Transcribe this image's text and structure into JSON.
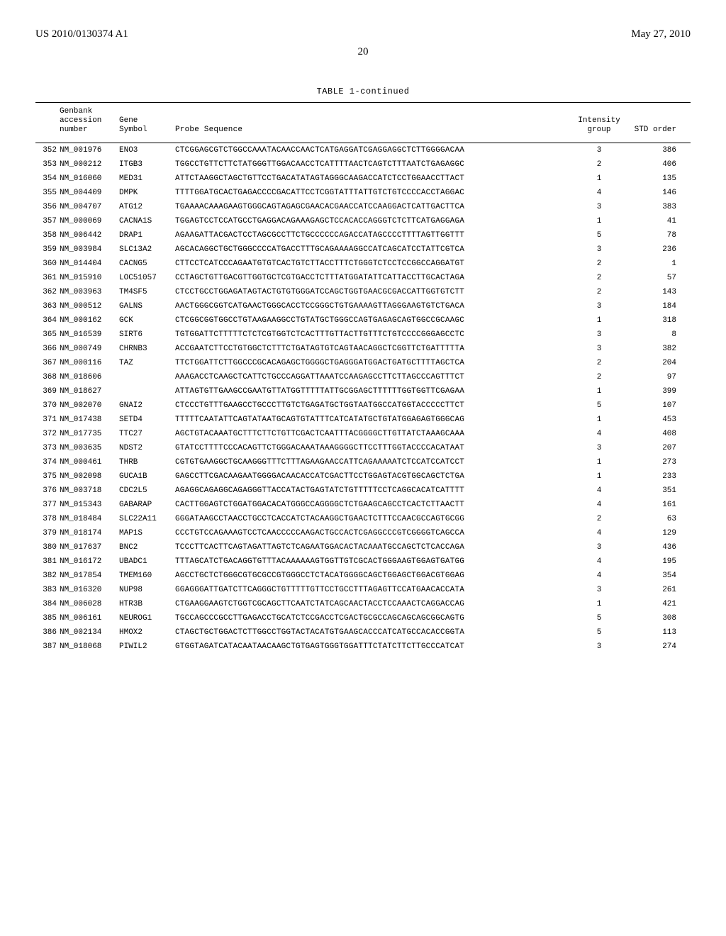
{
  "header": {
    "left": "US 2010/0130374 A1",
    "right": "May 27, 2010"
  },
  "page_number": "20",
  "table": {
    "title": "TABLE 1-continued",
    "columns": {
      "accession": "Genbank\naccession\nnumber",
      "symbol": "Gene\nSymbol",
      "sequence": "Probe Sequence",
      "intensity": "Intensity\ngroup",
      "std": "STD order"
    },
    "rows": [
      {
        "idx": "352",
        "acc": "NM_001976",
        "sym": "ENO3",
        "seq": "CTCGGAGCGTCTGGCCAAATACAACCAACTCATGAGGATCGAGGAGGCTCTTGGGGACAA",
        "int": "3",
        "std": "386"
      },
      {
        "idx": "353",
        "acc": "NM_000212",
        "sym": "ITGB3",
        "seq": "TGGCCTGTTCTTCTATGGGTTGGACAACCTCATTTTAACTCAGTCTTTAATCTGAGAGGC",
        "int": "2",
        "std": "406"
      },
      {
        "idx": "354",
        "acc": "NM_016060",
        "sym": "MED31",
        "seq": "ATTCTAAGGCTAGCTGTTCCTGACATATAGTAGGGCAAGACCATCTCCTGGAACCTTACT",
        "int": "1",
        "std": "135"
      },
      {
        "idx": "355",
        "acc": "NM_004409",
        "sym": "DMPK",
        "seq": "TTTTGGATGCACTGAGACCCCGACATTCCTCGGTATTTATTGTCTGTCCCCACCTAGGAC",
        "int": "4",
        "std": "146"
      },
      {
        "idx": "356",
        "acc": "NM_004707",
        "sym": "ATG12",
        "seq": "TGAAAACAAAGAAGTGGGCAGTAGAGCGAACACGAACCATCCAAGGACTCATTGACTTCA",
        "int": "3",
        "std": "383"
      },
      {
        "idx": "357",
        "acc": "NM_000069",
        "sym": "CACNA1S",
        "seq": "TGGAGTCCTCCATGCCTGAGGACAGAAAGAGCTCCACACCAGGGTCTCTTCATGAGGAGA",
        "int": "1",
        "std": "41"
      },
      {
        "idx": "358",
        "acc": "NM_006442",
        "sym": "DRAP1",
        "seq": "AGAAGATTACGACTCCTAGCGCCTTCTGCCCCCCAGACCATAGCCCCTTTTAGTTGGTTT",
        "int": "5",
        "std": "78"
      },
      {
        "idx": "359",
        "acc": "NM_003984",
        "sym": "SLC13A2",
        "seq": "AGCACAGGCTGCTGGGCCCCATGACCTTTGCAGAAAAGGCCATCAGCATCCTATTCGTCA",
        "int": "3",
        "std": "236"
      },
      {
        "idx": "360",
        "acc": "NM_014404",
        "sym": "CACNG5",
        "seq": "CTTCCTCATCCCAGAATGTGTCACTGTCTTACCTTTCTGGGTCTCCTCCGGCCAGGATGT",
        "int": "2",
        "std": "1"
      },
      {
        "idx": "361",
        "acc": "NM_015910",
        "sym": "LOC51057",
        "seq": "CCTAGCTGTTGACGTTGGTGCTCGTGACCTCTTTATGGATATTCATTACCTTGCACTAGA",
        "int": "2",
        "std": "57"
      },
      {
        "idx": "362",
        "acc": "NM_003963",
        "sym": "TM4SF5",
        "seq": "CTCCTGCCTGGAGATAGTACTGTGTGGGATCCAGCTGGTGAACGCGACCATTGGTGTCTT",
        "int": "2",
        "std": "143"
      },
      {
        "idx": "363",
        "acc": "NM_000512",
        "sym": "GALNS",
        "seq": "AACTGGGCGGTCATGAACTGGGCACCTCCGGGCTGTGAAAAGTTAGGGAAGTGTCTGACA",
        "int": "3",
        "std": "184"
      },
      {
        "idx": "364",
        "acc": "NM_000162",
        "sym": "GCK",
        "seq": "CTCGGCGGTGGCCTGTAAGAAGGCCTGTATGCTGGGCCAGTGAGAGCAGTGGCCGCAAGC",
        "int": "1",
        "std": "318"
      },
      {
        "idx": "365",
        "acc": "NM_016539",
        "sym": "SIRT6",
        "seq": "TGTGGATTCTTTTTCTCTCGTGGTCTCACTTTGTTACTTGTTTCTGTCCCCGGGAGCCTC",
        "int": "3",
        "std": "8"
      },
      {
        "idx": "366",
        "acc": "NM_000749",
        "sym": "CHRNB3",
        "seq": "ACCGAATCTTCCTGTGGCTCTTTCTGATAGTGTCAGTAACAGGCTCGGTTCTGATTTTTA",
        "int": "3",
        "std": "382"
      },
      {
        "idx": "367",
        "acc": "NM_000116",
        "sym": "TAZ",
        "seq": "TTCTGGATTCTTGGCCCGCACAGAGCTGGGGCTGAGGGATGGACTGATGCTTTTAGCTCA",
        "int": "2",
        "std": "204"
      },
      {
        "idx": "368",
        "acc": "NM_018606",
        "sym": "",
        "seq": "AAAGACCTCAAGCTCATTCTGCCCAGGATTAAATCCAAGAGCCTTCTTAGCCCAGTTTCT",
        "int": "2",
        "std": "97"
      },
      {
        "idx": "369",
        "acc": "NM_018627",
        "sym": "",
        "seq": "ATTAGTGTTGAAGCCGAATGTTATGGTTTTTATTGCGGAGCTTTTTTGGTGGTTCGAGAA",
        "int": "1",
        "std": "399"
      },
      {
        "idx": "370",
        "acc": "NM_002070",
        "sym": "GNAI2",
        "seq": "CTCCCTGTTTGAAGCCTGCCCTTGTCTGAGATGCTGGTAATGGCCATGGTACCCCCTTCT",
        "int": "5",
        "std": "107"
      },
      {
        "idx": "371",
        "acc": "NM_017438",
        "sym": "SETD4",
        "seq": "TTTTTCAATATTCAGTATAATGCAGTGTATTTCATCATATGCTGTATGGAGAGTGGGCAG",
        "int": "1",
        "std": "453"
      },
      {
        "idx": "372",
        "acc": "NM_017735",
        "sym": "TTC27",
        "seq": "AGCTGTACAAATGCTTTCTTCTGTTCGACTCAATTTACGGGGCTTGTTATCTAAAGCAAA",
        "int": "4",
        "std": "408"
      },
      {
        "idx": "373",
        "acc": "NM_003635",
        "sym": "NDST2",
        "seq": "GTATCCTTTTCCCACAGTTCTGGGACAAATAAAGGGGCTTCCTTTGGTACCCCACATAAT",
        "int": "3",
        "std": "207"
      },
      {
        "idx": "374",
        "acc": "NM_000461",
        "sym": "THRB",
        "seq": "CGTGTGAAGGCTGCAAGGGTTTCTTTAGAAGAACCATTCAGAAAAATCTCCATCCATCCT",
        "int": "1",
        "std": "273"
      },
      {
        "idx": "375",
        "acc": "NM_002098",
        "sym": "GUCA1B",
        "seq": "GAGCCTTCGACAAGAATGGGGACAACACCATCGACTTCCTGGAGTACGTGGCAGCTCTGA",
        "int": "1",
        "std": "233"
      },
      {
        "idx": "376",
        "acc": "NM_003718",
        "sym": "CDC2L5",
        "seq": "AGAGGCAGAGGCAGAGGGTTACCATACTGAGTATCTGTTTTTCCTCAGGCACATCATTTT",
        "int": "4",
        "std": "351"
      },
      {
        "idx": "377",
        "acc": "NM_015343",
        "sym": "GABARAP",
        "seq": "CACTTGGAGTCTGGATGGACACATGGGCCAGGGGCTCTGAAGCAGCCTCACTCTTAACTT",
        "int": "4",
        "std": "161"
      },
      {
        "idx": "378",
        "acc": "NM_018484",
        "sym": "SLC22A11",
        "seq": "GGGATAAGCCTAACCTGCCTCACCATCTACAAGGCTGAACTCTTTCCAACGCCAGTGCGG",
        "int": "2",
        "std": "63"
      },
      {
        "idx": "379",
        "acc": "NM_018174",
        "sym": "MAP1S",
        "seq": "CCCTGTCCAGAAAGTCCTCAACCCCCAAGACTGCCACTCGAGGCCCGTCGGGGTCAGCCA",
        "int": "4",
        "std": "129"
      },
      {
        "idx": "380",
        "acc": "NM_017637",
        "sym": "BNC2",
        "seq": "TCCCTTCACTTCAGTAGATTAGTCTCAGAATGGACACTACAAATGCCAGCTCTCACCAGA",
        "int": "3",
        "std": "436"
      },
      {
        "idx": "381",
        "acc": "NM_016172",
        "sym": "UBADC1",
        "seq": "TTTAGCATCTGACAGGTGTTTACAAAAAAGTGGTTGTCGCACTGGGAAGTGGAGTGATGG",
        "int": "4",
        "std": "195"
      },
      {
        "idx": "382",
        "acc": "NM_017854",
        "sym": "TMEM160",
        "seq": "AGCCTGCTCTGGGCGTGCGCCGTGGGCCTCTACATGGGGCAGCTGGAGCTGGACGTGGAG",
        "int": "4",
        "std": "354"
      },
      {
        "idx": "383",
        "acc": "NM_016320",
        "sym": "NUP98",
        "seq": "GGAGGGATTGATCTTCAGGGCTGTTTTTGTTCCTGCCTTTAGAGTTCCATGAACACCATA",
        "int": "3",
        "std": "261"
      },
      {
        "idx": "384",
        "acc": "NM_006028",
        "sym": "HTR3B",
        "seq": "CTGAAGGAAGTCTGGTCGCAGCTTCAATCTATCAGCAACTACCTCCAAACTCAGGACCAG",
        "int": "1",
        "std": "421"
      },
      {
        "idx": "385",
        "acc": "NM_006161",
        "sym": "NEUROG1",
        "seq": "TGCCAGCCCGCCTTGAGACCTGCATCTCCGACCTCGACTGCGCCAGCAGCAGCGGCAGTG",
        "int": "5",
        "std": "308"
      },
      {
        "idx": "386",
        "acc": "NM_002134",
        "sym": "HMOX2",
        "seq": "CTAGCTGCTGGACTCTTGGCCTGGTACTACATGTGAAGCACCCATCATGCCACACCGGTA",
        "int": "5",
        "std": "113"
      },
      {
        "idx": "387",
        "acc": "NM_018068",
        "sym": "PIWIL2",
        "seq": "GTGGTAGATCATACAATAACAAGCTGTGAGTGGGTGGATTTCTATCTTCTTGCCCATCAT",
        "int": "3",
        "std": "274"
      }
    ]
  }
}
